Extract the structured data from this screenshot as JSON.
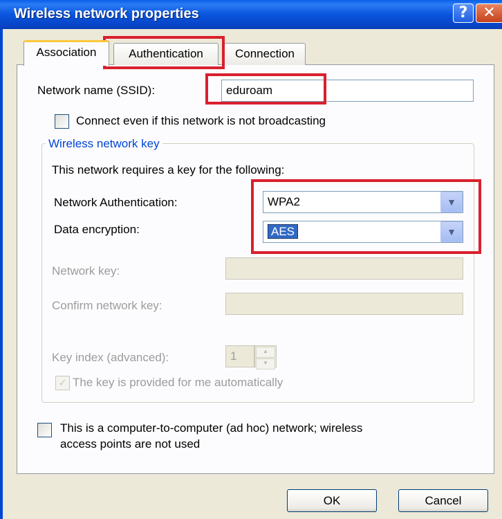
{
  "window": {
    "title": "Wireless network properties"
  },
  "titlebar_buttons": {
    "help": "?",
    "close": "✕"
  },
  "tabs": [
    "Association",
    "Authentication",
    "Connection"
  ],
  "association": {
    "ssid_label": "Network name (SSID):",
    "ssid_value": "eduroam",
    "connect_nonbroadcast_label": "Connect even if this network is not broadcasting",
    "key_group": {
      "legend": "Wireless network key",
      "intro": "This network requires a key for the following:",
      "auth_label": "Network Authentication:",
      "auth_value": "WPA2",
      "encryption_label": "Data encryption:",
      "encryption_value": "AES",
      "network_key_label": "Network key:",
      "network_key_value": "",
      "confirm_key_label": "Confirm network key:",
      "confirm_key_value": "",
      "key_index_label": "Key index (advanced):",
      "key_index_value": "1",
      "auto_key_label": "The key is provided for me automatically"
    },
    "adhoc_label_line1": "This is a computer-to-computer (ad hoc) network; wireless",
    "adhoc_label_line2": "access points are not used"
  },
  "buttons": {
    "ok": "OK",
    "cancel": "Cancel"
  },
  "colors": {
    "titlebar": "#0a55de",
    "highlight": "#d9202e",
    "group_legend": "#0046d5"
  },
  "icons": {
    "dropdown": "chevron-down-icon",
    "check": "checkmark-icon"
  }
}
